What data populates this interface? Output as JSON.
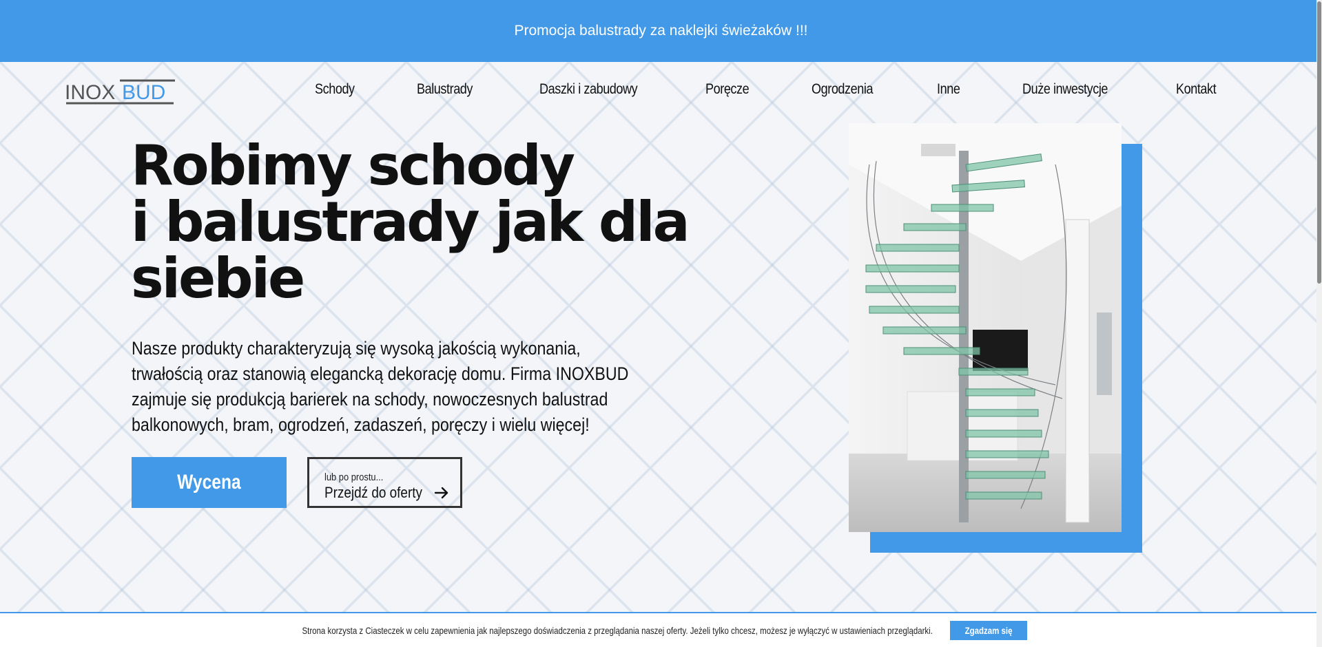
{
  "promo": {
    "text": "Promocja balustrady za naklejki świeżaków !!!"
  },
  "logo": {
    "part1": "INOX",
    "part2": "BUD"
  },
  "nav": {
    "items": [
      {
        "label": "Schody"
      },
      {
        "label": "Balustrady"
      },
      {
        "label": "Daszki i zabudowy"
      },
      {
        "label": "Poręcze"
      },
      {
        "label": "Ogrodzenia"
      },
      {
        "label": "Inne"
      },
      {
        "label": "Duże inwestycje"
      },
      {
        "label": "Kontakt"
      }
    ]
  },
  "hero": {
    "title_lines": [
      "Robimy schody",
      "i balustrady jak dla",
      "siebie"
    ],
    "text": "Nasze produkty charakteryzują się wysoką jakością wykonania, trwałością oraz stanowią elegancką dekorację domu. Firma INOXBUD zajmuje się produkcją barierek na schody, nowoczesnych balustrad balkonowych, bram, ogrodzeń, zadaszeń, poręczy i wielu więcej!",
    "quote_button": "Wycena",
    "offer_small": "lub po prostu...",
    "offer_label": "Przejdź do oferty",
    "offer_icon": "arrow-right-icon"
  },
  "cookie": {
    "text": "Strona korzysta z Ciasteczek w celu zapewnienia jak najlepszego doświadczenia z przeglądania naszej oferty. Jeżeli tylko chcesz, możesz je wyłączyć w ustawieniach przeglądarki.",
    "accept": "Zgadzam się"
  },
  "colors": {
    "accent": "#4199e7",
    "text": "#111111",
    "background": "#f3f5f8"
  }
}
